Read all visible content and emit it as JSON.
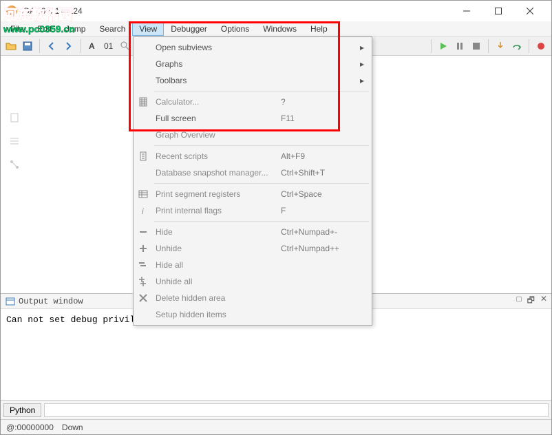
{
  "window": {
    "title": "IDA v6.5.140124"
  },
  "watermark": {
    "line1": "河东软件园",
    "line2": "www.pc0359.cn"
  },
  "menubar": [
    "File",
    "Edit",
    "Jump",
    "Search",
    "View",
    "Debugger",
    "Options",
    "Windows",
    "Help"
  ],
  "menubar_active_index": 4,
  "view_menu": {
    "groups": [
      [
        {
          "label": "Open subviews",
          "shortcut": "",
          "submenu": true,
          "disabled": false
        },
        {
          "label": "Graphs",
          "shortcut": "",
          "submenu": true,
          "disabled": false
        },
        {
          "label": "Toolbars",
          "shortcut": "",
          "submenu": true,
          "disabled": false
        }
      ],
      [
        {
          "label": "Calculator...",
          "shortcut": "?",
          "disabled": true,
          "icon": "calculator"
        },
        {
          "label": "Full screen",
          "shortcut": "F11",
          "disabled": false
        },
        {
          "label": "Graph Overview",
          "shortcut": "",
          "disabled": true
        }
      ],
      [
        {
          "label": "Recent scripts",
          "shortcut": "Alt+F9",
          "disabled": true,
          "icon": "script"
        },
        {
          "label": "Database snapshot manager...",
          "shortcut": "Ctrl+Shift+T",
          "disabled": true
        }
      ],
      [
        {
          "label": "Print segment registers",
          "shortcut": "Ctrl+Space",
          "disabled": true,
          "icon": "registers"
        },
        {
          "label": "Print internal flags",
          "shortcut": "F",
          "disabled": true,
          "icon": "info"
        }
      ],
      [
        {
          "label": "Hide",
          "shortcut": "Ctrl+Numpad+-",
          "disabled": true,
          "icon": "minus"
        },
        {
          "label": "Unhide",
          "shortcut": "Ctrl+Numpad++",
          "disabled": true,
          "icon": "plus"
        },
        {
          "label": "Hide all",
          "shortcut": "",
          "disabled": true,
          "icon": "minus-all"
        },
        {
          "label": "Unhide all",
          "shortcut": "",
          "disabled": true,
          "icon": "plus-all"
        },
        {
          "label": "Delete hidden area",
          "shortcut": "",
          "disabled": true,
          "icon": "delete"
        },
        {
          "label": "Setup hidden items",
          "shortcut": "",
          "disabled": true
        }
      ]
    ]
  },
  "output": {
    "title": "Output window",
    "text": "Can not set debug privilege: 并非所有被引用的特权或组都分配给呼叫方."
  },
  "cmd": {
    "button": "Python"
  },
  "status": {
    "addr": "@:00000000",
    "state": "Down"
  }
}
